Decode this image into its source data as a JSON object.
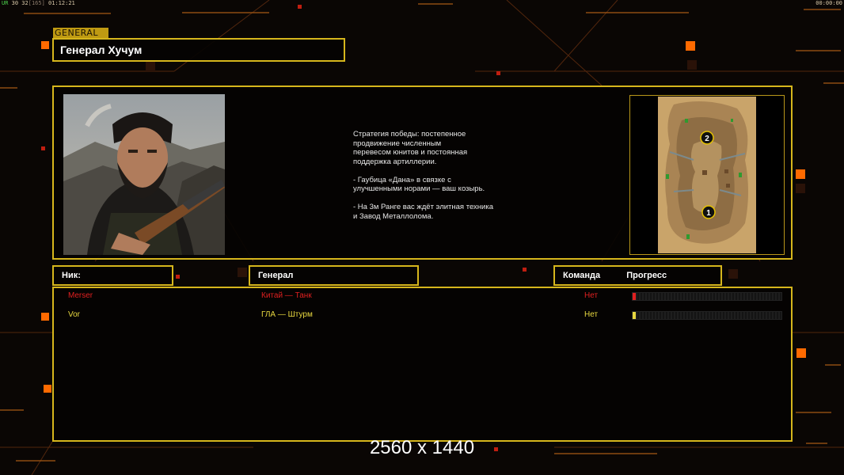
{
  "hud": {
    "top_left_green": "UR",
    "top_left_stats": "30 32",
    "top_left_bracket": "[165]",
    "top_left_time": "01:12:21",
    "top_right_time": "00:00:00"
  },
  "general": {
    "tag": "GENERAL",
    "name": "Генерал Хучум",
    "description": "Стратегия победы: постепенное\nпродвижение численным\nперевесом юнитов и постоянная\nподдержка артиллерии.\n\n- Гаубица «Дана» в связке с\nулучшенными норами — ваш козырь.\n\n- На 3м Ранге вас ждёт элитная техника\nи Завод Металлолома.",
    "map_markers": [
      "2",
      "1"
    ]
  },
  "headers": {
    "nick": "Ник:",
    "general": "Генерал",
    "team": "Команда",
    "progress": "Прогресс"
  },
  "players": [
    {
      "nick": "Merser",
      "general": "Китай — Танк",
      "team": "Нет",
      "progress": 0.02,
      "color": "#e02020"
    },
    {
      "nick": "Vor",
      "general": "ГЛА — Штурм",
      "team": "Нет",
      "progress": 0.02,
      "color": "#e8d840"
    }
  ],
  "colors": {
    "frame": "#d6b61c",
    "accent_orange": "#ff6a00"
  },
  "resolution": "2560 x 1440"
}
